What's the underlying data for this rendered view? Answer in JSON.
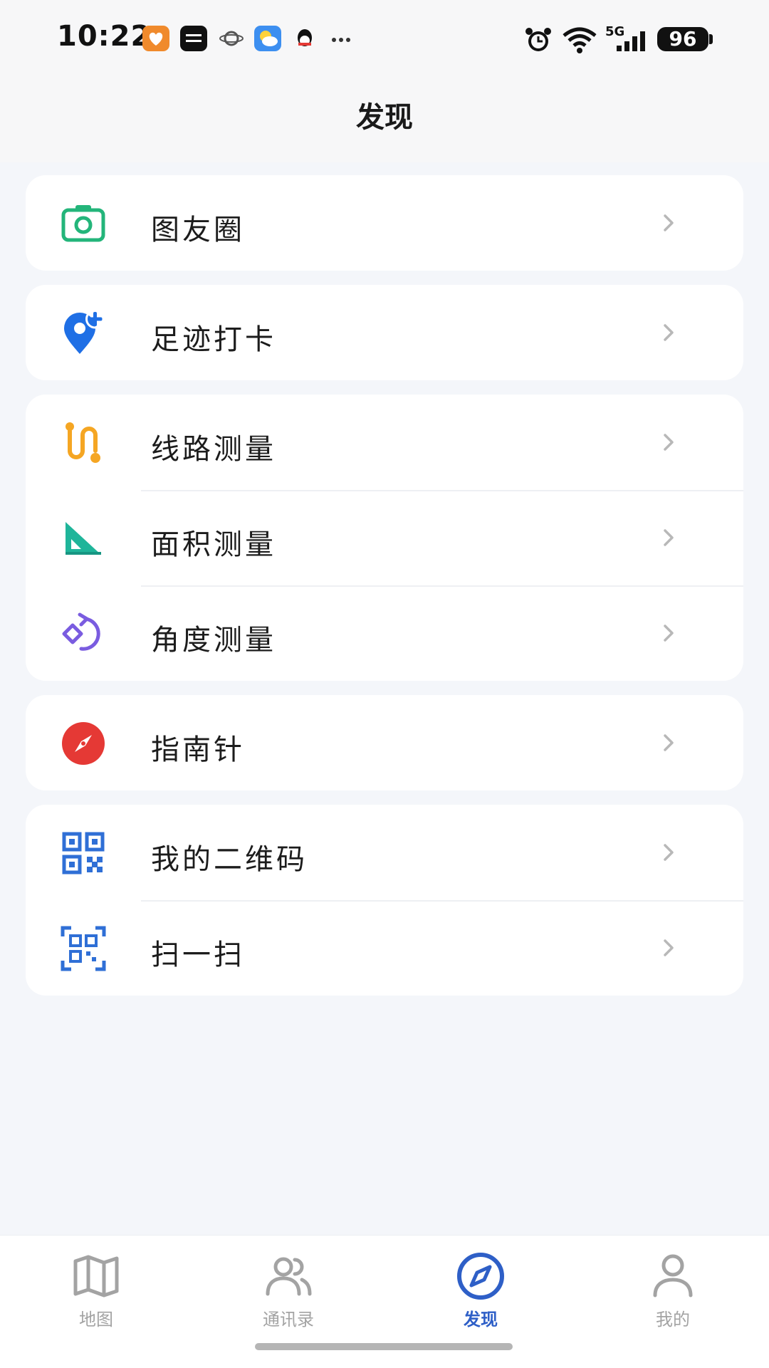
{
  "status_bar": {
    "time": "10:22",
    "battery": "96",
    "network": "5G"
  },
  "header": {
    "title": "发现"
  },
  "groups": [
    {
      "items": [
        {
          "label": "图友圈",
          "icon": "camera-icon",
          "color": "#23b57a"
        }
      ]
    },
    {
      "items": [
        {
          "label": "足迹打卡",
          "icon": "location-pin-plus-icon",
          "color": "#1f6fe5"
        }
      ]
    },
    {
      "items": [
        {
          "label": "线路测量",
          "icon": "route-icon",
          "color": "#f5a623"
        },
        {
          "label": "面积测量",
          "icon": "triangle-ruler-icon",
          "color": "#1fb59a"
        },
        {
          "label": "角度测量",
          "icon": "angle-rotate-icon",
          "color": "#7a5ce0"
        }
      ]
    },
    {
      "items": [
        {
          "label": "指南针",
          "icon": "compass-icon",
          "color": "#e53935"
        }
      ]
    },
    {
      "items": [
        {
          "label": "我的二维码",
          "icon": "qr-code-icon",
          "color": "#2f6fd6"
        },
        {
          "label": "扫一扫",
          "icon": "scan-icon",
          "color": "#2f6fd6"
        }
      ]
    }
  ],
  "tabbar": {
    "tabs": [
      {
        "label": "地图",
        "icon": "map-icon",
        "active": false
      },
      {
        "label": "通讯录",
        "icon": "contacts-icon",
        "active": false
      },
      {
        "label": "发现",
        "icon": "compass-tab-icon",
        "active": true
      },
      {
        "label": "我的",
        "icon": "user-icon",
        "active": false
      }
    ],
    "active_color": "#2e5fc7",
    "inactive_color": "#a3a3a3"
  }
}
